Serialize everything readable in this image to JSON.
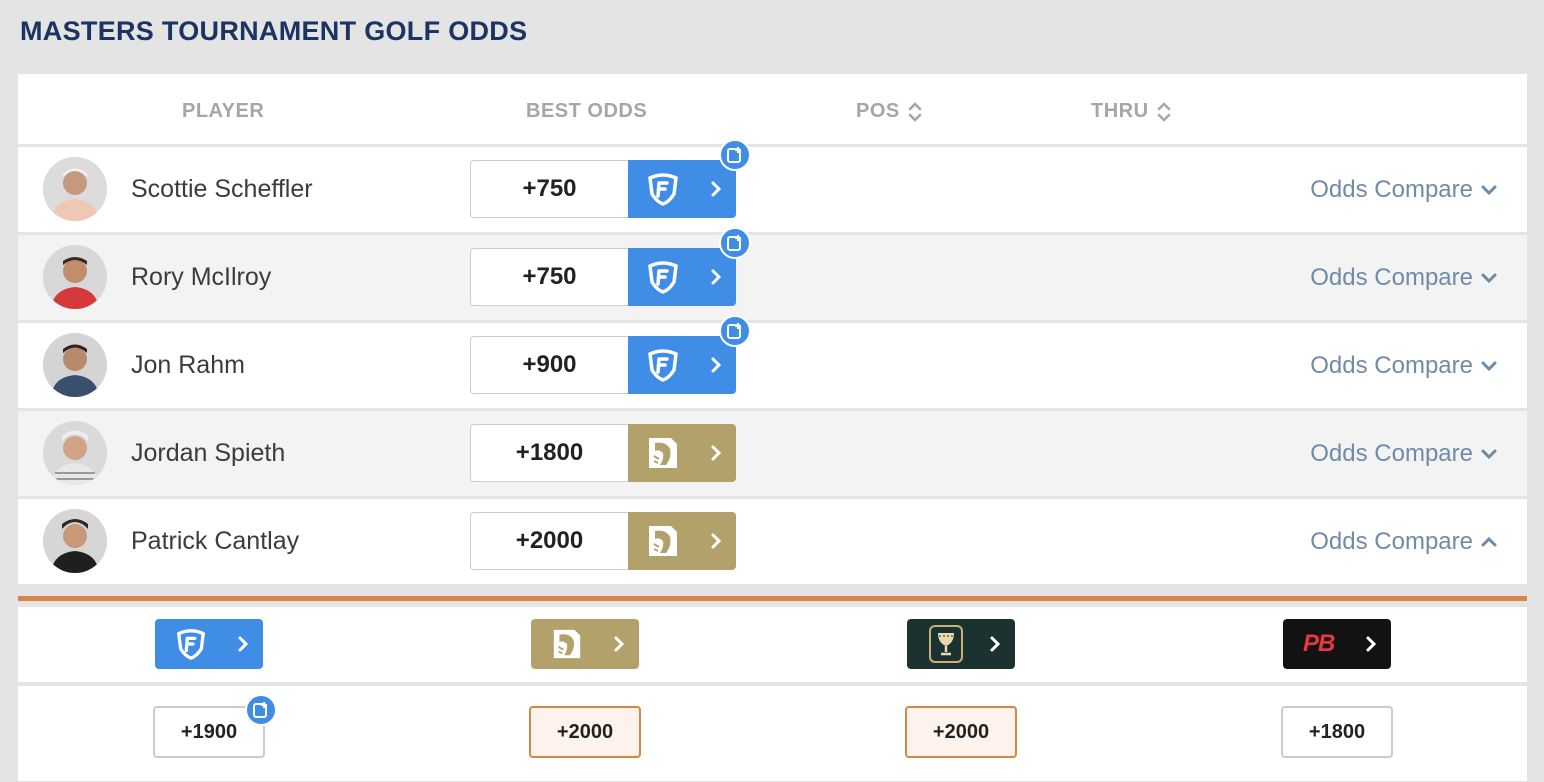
{
  "title": "MASTERS TOURNAMENT GOLF ODDS",
  "headers": {
    "player": "PLAYER",
    "best_odds": "BEST ODDS",
    "pos": "POS",
    "thru": "THRU"
  },
  "rows": [
    {
      "name": "Scottie Scheffler",
      "odds": "+750",
      "book": "fanduel",
      "has_add_badge": true,
      "compare": "Odds Compare",
      "expanded": false
    },
    {
      "name": "Rory McIlroy",
      "odds": "+750",
      "book": "fanduel",
      "has_add_badge": true,
      "compare": "Odds Compare",
      "expanded": false
    },
    {
      "name": "Jon Rahm",
      "odds": "+900",
      "book": "fanduel",
      "has_add_badge": true,
      "compare": "Odds Compare",
      "expanded": false
    },
    {
      "name": "Jordan Spieth",
      "odds": "+1800",
      "book": "betmgm",
      "has_add_badge": false,
      "compare": "Odds Compare",
      "expanded": false
    },
    {
      "name": "Patrick Cantlay",
      "odds": "+2000",
      "book": "betmgm",
      "has_add_badge": false,
      "compare": "Odds Compare",
      "expanded": true
    }
  ],
  "compare_panel": {
    "books": [
      {
        "id": "fanduel",
        "odds": "+1900",
        "highlight": false,
        "has_add_badge": true
      },
      {
        "id": "betmgm",
        "odds": "+2000",
        "highlight": true,
        "has_add_badge": false
      },
      {
        "id": "caesars",
        "odds": "+2000",
        "highlight": true,
        "has_add_badge": false
      },
      {
        "id": "pointsbet",
        "odds": "+1800",
        "highlight": false,
        "has_add_badge": false
      }
    ],
    "pointsbet_logo_text": "PB"
  },
  "colors": {
    "title": "#1c3461",
    "fanduel": "#3f8de4",
    "betmgm": "#b3a16b",
    "caesars": "#1c3230",
    "pointsbet": "#121212",
    "accent_line": "#d68745",
    "compare_link": "#6f8ba8"
  }
}
